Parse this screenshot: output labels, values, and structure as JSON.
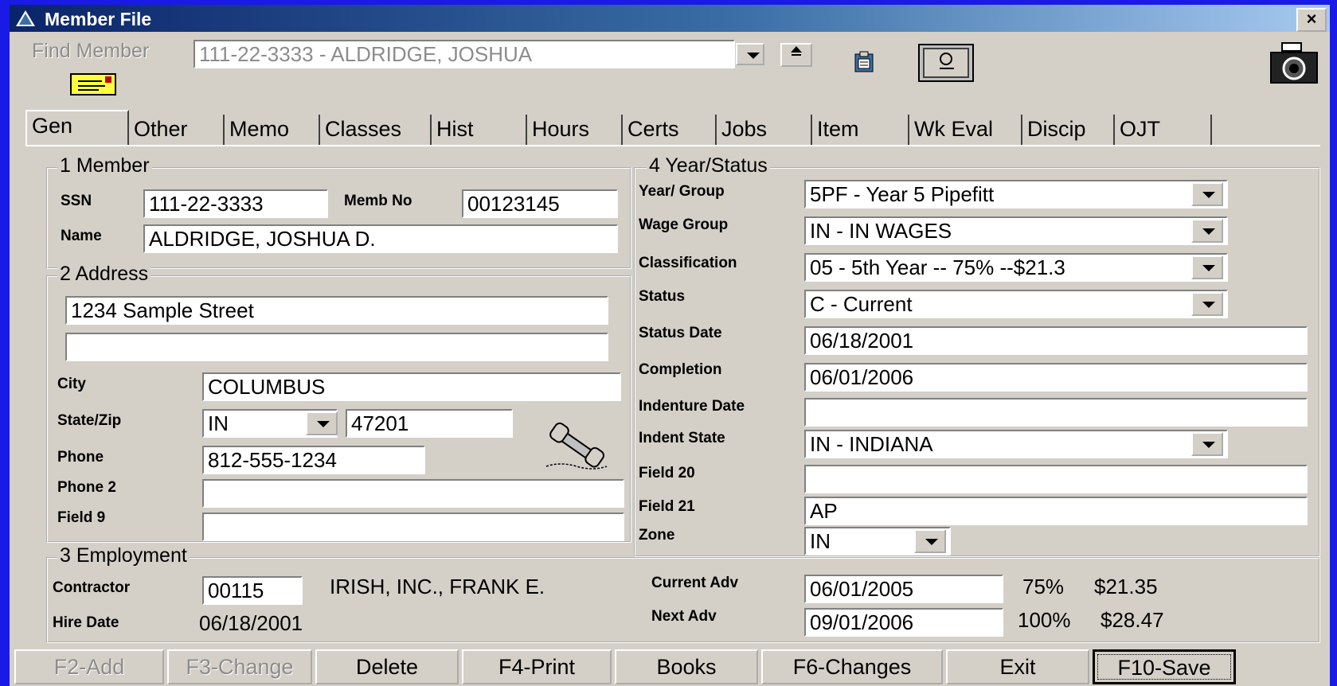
{
  "window": {
    "title": "Member File",
    "close_label": "×"
  },
  "find": {
    "label": "Find Member",
    "value": "111-22-3333 - ALDRIDGE, JOSHUA"
  },
  "tabs": [
    {
      "label": "Gen"
    },
    {
      "label": "Other"
    },
    {
      "label": "Memo"
    },
    {
      "label": "Classes"
    },
    {
      "label": "Hist"
    },
    {
      "label": "Hours"
    },
    {
      "label": "Certs"
    },
    {
      "label": "Jobs"
    },
    {
      "label": "Item"
    },
    {
      "label": "Wk Eval"
    },
    {
      "label": "Discip"
    },
    {
      "label": "OJT"
    }
  ],
  "member": {
    "title": "1 Member",
    "ssn_label": "SSN",
    "ssn": "111-22-3333",
    "memb_no_label": "Memb No",
    "memb_no": "00123145",
    "name_label": "Name",
    "name": "ALDRIDGE, JOSHUA D."
  },
  "address": {
    "title": "2 Address",
    "line1": "1234 Sample Street",
    "line2": "",
    "city_label": "City",
    "city": "COLUMBUS",
    "statezip_label": "State/Zip",
    "state": "IN",
    "zip": "47201",
    "phone_label": "Phone",
    "phone": "812-555-1234",
    "phone2_label": "Phone 2",
    "phone2": "",
    "field9_label": "Field 9",
    "field9": ""
  },
  "employment": {
    "title": "3 Employment",
    "contractor_label": "Contractor",
    "contractor_code": "00115",
    "contractor_name": "IRISH, INC., FRANK E.",
    "hire_label": "Hire Date",
    "hire_date": "06/18/2001",
    "current_adv_label": "Current Adv",
    "current_adv": "06/01/2005",
    "current_pct": "75%",
    "current_rate": "$21.35",
    "next_adv_label": "Next Adv",
    "next_adv": "09/01/2006",
    "next_pct": "100%",
    "next_rate": "$28.47"
  },
  "year_status": {
    "title": "4 Year/Status",
    "year_group_label": "Year/ Group",
    "year_group": "5PF  - Year 5 Pipefitt",
    "wage_group_label": "Wage Group",
    "wage_group": "IN   - IN WAGES",
    "classification_label": "Classification",
    "classification": "05   - 5th Year -- 75% --$21.3",
    "status_label": "Status",
    "status": "C    - Current",
    "status_date_label": "Status Date",
    "status_date": "06/18/2001",
    "completion_label": "Completion",
    "completion": "06/01/2006",
    "indenture_label": "Indenture Date",
    "indenture": "",
    "indent_state_label": "Indent State",
    "indent_state": "IN   - INDIANA",
    "field20_label": "Field 20",
    "field20": "",
    "field21_label": "Field 21",
    "field21": "AP",
    "zone_label": "Zone",
    "zone": "IN"
  },
  "buttons": [
    {
      "label": "F2-Add"
    },
    {
      "label": "F3-Change"
    },
    {
      "label": "Delete"
    },
    {
      "label": "F4-Print"
    },
    {
      "label": "Books"
    },
    {
      "label": "F6-Changes"
    },
    {
      "label": "Exit"
    },
    {
      "label": "F10-Save"
    }
  ],
  "colors": {
    "background": "#1a1ae6",
    "face": "#d4d0c8",
    "title_start": "#0a246a"
  }
}
